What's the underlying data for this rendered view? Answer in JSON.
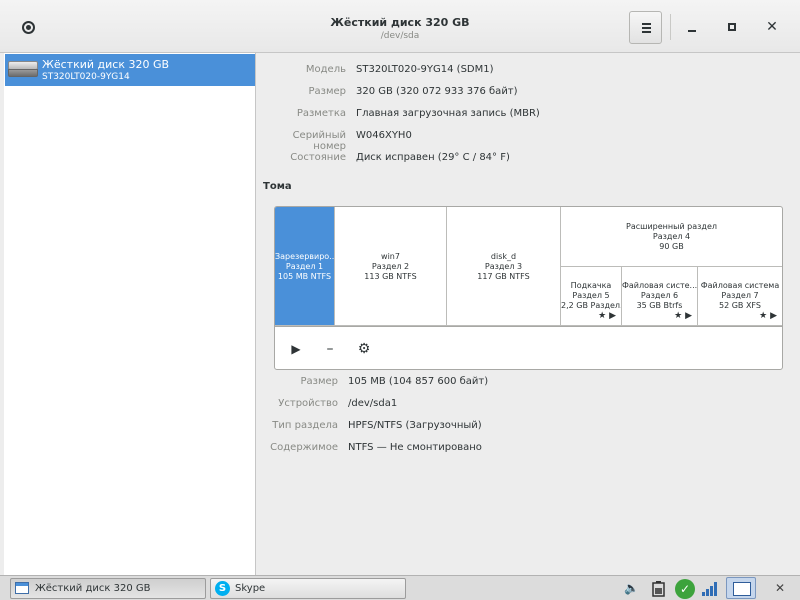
{
  "window": {
    "title": "Жёсткий диск 320 GB",
    "subtitle": "/dev/sda"
  },
  "sidebar": {
    "disk": {
      "name": "Жёсткий диск 320 GB",
      "model": "ST320LT020-9YG14"
    }
  },
  "drive": {
    "model_label": "Модель",
    "model_value": "ST320LT020-9YG14 (SDM1)",
    "size_label": "Размер",
    "size_value": "320 GB (320 072 933 376 байт)",
    "partitioning_label": "Разметка",
    "partitioning_value": "Главная загрузочная запись (MBR)",
    "serial_label": "Серийный номер",
    "serial_value": "W046XYH0",
    "status_label": "Состояние",
    "status_value": "Диск исправен (29° C / 84° F)"
  },
  "volumes": {
    "section_title": "Тома",
    "partitions": [
      {
        "line1": "Зарезервиро...",
        "line2": "Раздел 1",
        "line3": "105 MB NTFS"
      },
      {
        "line1": "win7",
        "line2": "Раздел 2",
        "line3": "113 GB NTFS"
      },
      {
        "line1": "disk_d",
        "line2": "Раздел 3",
        "line3": "117 GB NTFS"
      }
    ],
    "extended": {
      "line1": "Расширенный раздел",
      "line2": "Раздел 4",
      "line3": "90 GB"
    },
    "logical": [
      {
        "line1": "Подкачка",
        "line2": "Раздел 5",
        "line3": "2,2 GB Раздел..."
      },
      {
        "line1": "Файловая систе...",
        "line2": "Раздел 6",
        "line3": "35 GB Btrfs"
      },
      {
        "line1": "Файловая система",
        "line2": "Раздел 7",
        "line3": "52 GB XFS"
      }
    ]
  },
  "selected": {
    "size_label": "Размер",
    "size_value": "105 MB (104 857 600 байт)",
    "device_label": "Устройство",
    "device_value": "/dev/sda1",
    "type_label": "Тип раздела",
    "type_value": "HPFS/NTFS (Загрузочный)",
    "contents_label": "Содержимое",
    "contents_value": "NTFS — Не смонтировано"
  },
  "taskbar": {
    "tasks": [
      {
        "label": "Жёсткий диск 320 GB"
      },
      {
        "label": "Skype"
      }
    ]
  },
  "colors": {
    "selection": "#4a90d9",
    "tray_ok": "#3ca33c"
  }
}
